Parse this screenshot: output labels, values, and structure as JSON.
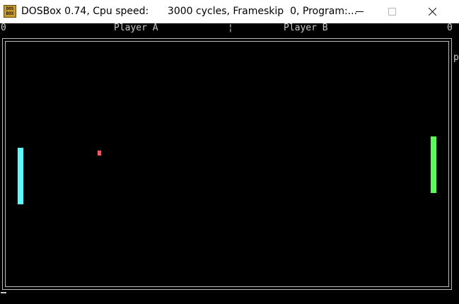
{
  "window": {
    "title": "DOSBox 0.74, Cpu speed:      3000 cycles, Frameskip  0, Program:...",
    "icon_label_line1": "DOS",
    "icon_label_line2": "BOX",
    "icon": "dosbox-icon",
    "controls": [
      "minimize-icon",
      "maximize-icon",
      "close-icon"
    ]
  },
  "game": {
    "player_a_score": "0",
    "player_a_label": "Player A",
    "divider": "¦",
    "player_b_label": "Player B",
    "player_b_score": "0",
    "edge_char": "p",
    "colors": {
      "left_paddle": "#55ffff",
      "right_paddle": "#55ff55",
      "ball": "#ff5555",
      "border": "#bdbdbd",
      "background": "#000000"
    }
  }
}
